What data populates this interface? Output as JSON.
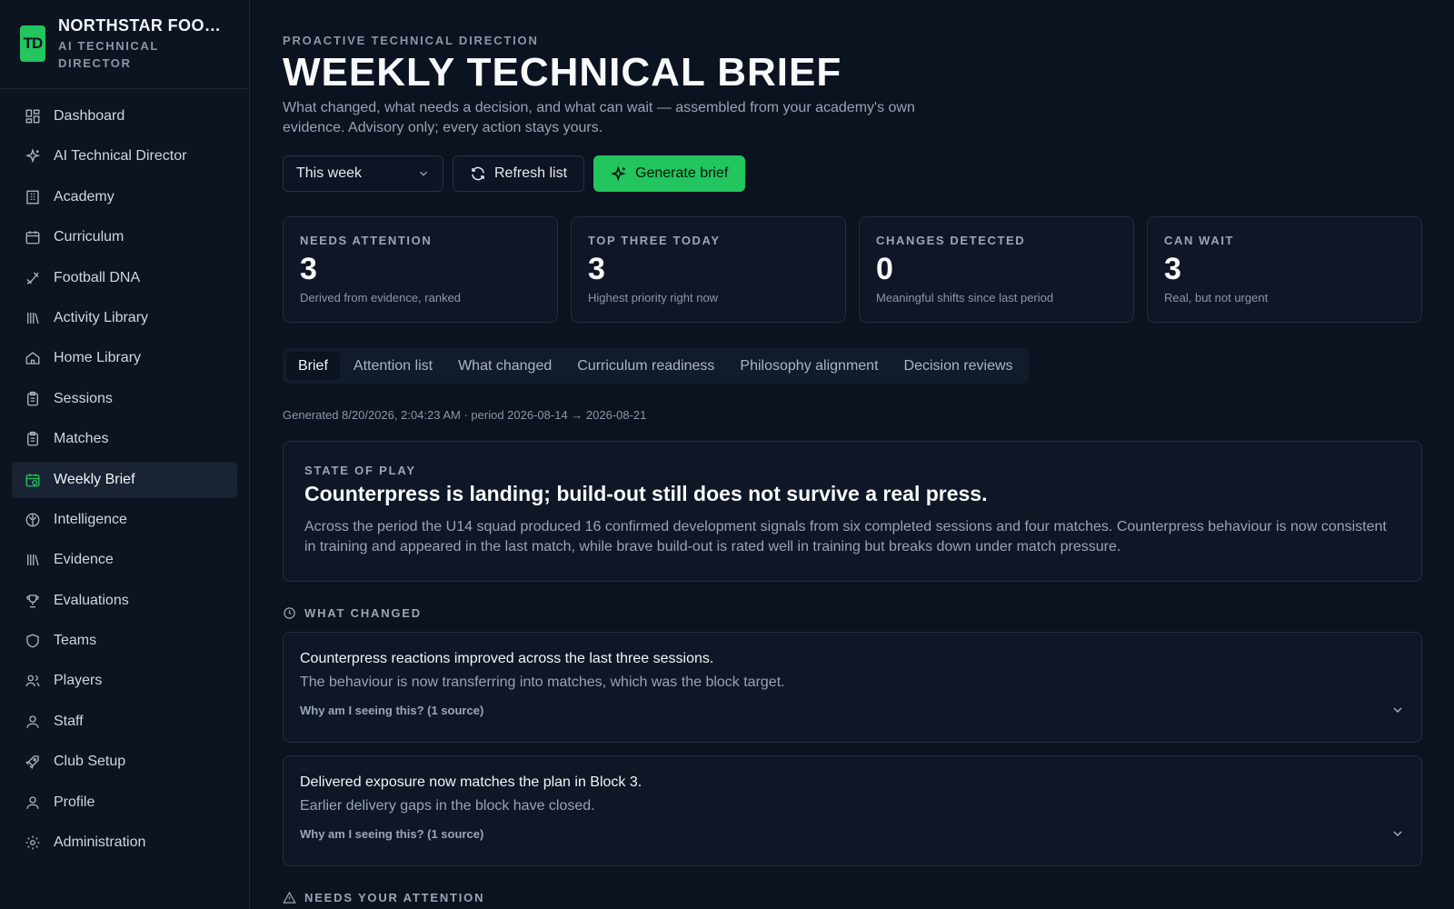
{
  "brand": {
    "initials": "TD",
    "name": "NORTHSTAR FOOTBALL",
    "subtitle": "AI TECHNICAL DIRECTOR"
  },
  "sidebar": {
    "items": [
      {
        "label": "Dashboard",
        "icon": "dashboard-icon"
      },
      {
        "label": "AI Technical Director",
        "icon": "sparkles-icon"
      },
      {
        "label": "Academy",
        "icon": "building-icon"
      },
      {
        "label": "Curriculum",
        "icon": "calendar-icon"
      },
      {
        "label": "Football DNA",
        "icon": "dna-icon"
      },
      {
        "label": "Activity Library",
        "icon": "library-icon"
      },
      {
        "label": "Home Library",
        "icon": "home-icon"
      },
      {
        "label": "Sessions",
        "icon": "clipboard-icon"
      },
      {
        "label": "Matches",
        "icon": "clipboard-icon"
      },
      {
        "label": "Weekly Brief",
        "icon": "calendar-clock-icon",
        "active": true
      },
      {
        "label": "Intelligence",
        "icon": "brain-icon"
      },
      {
        "label": "Evidence",
        "icon": "library-icon"
      },
      {
        "label": "Evaluations",
        "icon": "trophy-icon"
      },
      {
        "label": "Teams",
        "icon": "shield-icon"
      },
      {
        "label": "Players",
        "icon": "users-icon"
      },
      {
        "label": "Staff",
        "icon": "user-icon"
      },
      {
        "label": "Club Setup",
        "icon": "rocket-icon"
      },
      {
        "label": "Profile",
        "icon": "user-icon"
      },
      {
        "label": "Administration",
        "icon": "gear-icon"
      }
    ]
  },
  "header": {
    "eyebrow": "PROACTIVE TECHNICAL DIRECTION",
    "title": "WEEKLY TECHNICAL BRIEF",
    "subtitle": "What changed, what needs a decision, and what can wait — assembled from your academy's own evidence. Advisory only; every action stays yours."
  },
  "controls": {
    "period_select": "This week",
    "refresh_label": "Refresh list",
    "generate_label": "Generate brief"
  },
  "kpis": [
    {
      "label": "NEEDS ATTENTION",
      "value": "3",
      "desc": "Derived from evidence, ranked"
    },
    {
      "label": "TOP THREE TODAY",
      "value": "3",
      "desc": "Highest priority right now"
    },
    {
      "label": "CHANGES DETECTED",
      "value": "0",
      "desc": "Meaningful shifts since last period"
    },
    {
      "label": "CAN WAIT",
      "value": "3",
      "desc": "Real, but not urgent"
    }
  ],
  "tabs": [
    "Brief",
    "Attention list",
    "What changed",
    "Curriculum readiness",
    "Philosophy alignment",
    "Decision reviews"
  ],
  "generated": "Generated 8/20/2026, 2:04:23 AM · period 2026-08-14 → 2026-08-21",
  "state_of_play": {
    "label": "STATE OF PLAY",
    "headline": "Counterpress is landing; build-out still does not survive a real press.",
    "body": "Across the period the U14 squad produced 16 confirmed development signals from six completed sessions and four matches. Counterpress behaviour is now consistent in training and appeared in the last match, while brave build-out is rated well in training but breaks down under match pressure."
  },
  "what_changed": {
    "label": "WHAT CHANGED",
    "items": [
      {
        "title": "Counterpress reactions improved across the last three sessions.",
        "desc": "The behaviour is now transferring into matches, which was the block target.",
        "why": "Why am I seeing this? (1 source)"
      },
      {
        "title": "Delivered exposure now matches the plan in Block 3.",
        "desc": "Earlier delivery gaps in the block have closed.",
        "why": "Why am I seeing this? (1 source)"
      }
    ]
  },
  "needs_attention": {
    "label": "NEEDS YOUR ATTENTION"
  },
  "colors": {
    "accent": "#22c55e",
    "background": "#0b1220",
    "card": "#0f1727"
  }
}
